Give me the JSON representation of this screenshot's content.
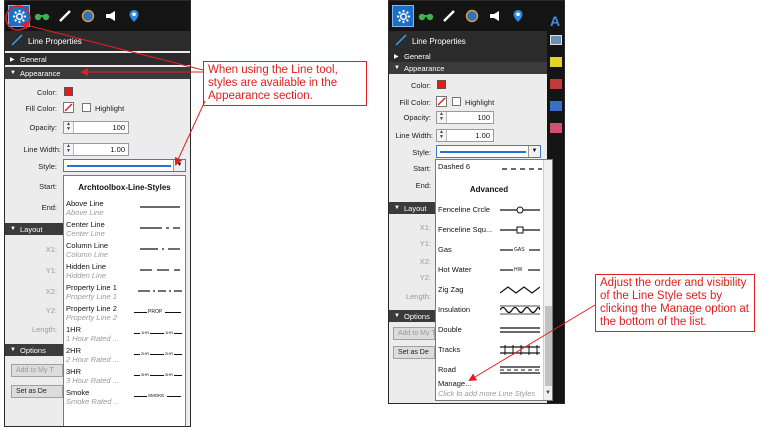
{
  "left_panel": {
    "title": "Line Properties",
    "sections": {
      "general": "General",
      "appearance": "Appearance",
      "layout": "Layout",
      "options": "Options"
    },
    "labels": {
      "color": "Color:",
      "fill_color": "Fill Color:",
      "highlight": "Highlight",
      "opacity": "Opacity:",
      "line_width": "Line Width:",
      "style": "Style:",
      "start": "Start:",
      "end": "End:",
      "x1": "X1:",
      "y1": "Y1:",
      "x2": "X2:",
      "y2": "Y2:",
      "length": "Length:"
    },
    "values": {
      "opacity": "100",
      "line_width": "1.00"
    },
    "buttons": {
      "add_to_my": "Add to My T",
      "set_as_default": "Set as De"
    },
    "style_list": {
      "header": "Archtoolbox-Line-Styles",
      "items": [
        {
          "name": "Above Line",
          "sub": "Above Line"
        },
        {
          "name": "Center Line",
          "sub": "Center Line"
        },
        {
          "name": "Column Line",
          "sub": "Column Line"
        },
        {
          "name": "Hidden Line",
          "sub": "Hidden Line"
        },
        {
          "name": "Property Line 1",
          "sub": "Property Line 1"
        },
        {
          "name": "Property Line 2",
          "sub": "Property Line 2"
        },
        {
          "name": "1HR",
          "sub": "1 Hour Rated ..."
        },
        {
          "name": "2HR",
          "sub": "2 Hour Rated ..."
        },
        {
          "name": "3HR",
          "sub": "3 Hour Rated ..."
        },
        {
          "name": "Smoke",
          "sub": "Smoke Rated ..."
        }
      ],
      "sample_labels": {
        "prop": "PROP",
        "1hr": "1HR",
        "1hr_b": "1HR",
        "2hr": "2HR",
        "2hr_b": "2HR",
        "3hr": "3HR",
        "3hr_b": "3HR",
        "smoke": "SMOKE"
      }
    }
  },
  "right_panel": {
    "title": "Line Properties",
    "sections": {
      "general": "General",
      "appearance": "Appearance",
      "layout": "Layout",
      "options": "Options"
    },
    "labels": {
      "color": "Color:",
      "fill_color": "Fill Color:",
      "highlight": "Highlight",
      "opacity": "Opacity:",
      "line_width": "Line Width:",
      "style": "Style:",
      "start": "Start:",
      "end": "End:",
      "x1": "X1:",
      "y1": "Y1:",
      "x2": "X2:",
      "y2": "Y2:",
      "length": "Length:"
    },
    "values": {
      "opacity": "100",
      "line_width": "1.00"
    },
    "buttons": {
      "add_to_my": "Add to My T",
      "set_as_default": "Set as De"
    },
    "style_list": {
      "top_item": "Dashed 6",
      "group_header": "Advanced",
      "items": [
        {
          "name": "Fenceline Crcle",
          "sample": "circle"
        },
        {
          "name": "Fenceline Squ...",
          "sample": "square"
        },
        {
          "name": "Gas",
          "sample": "gas",
          "tag": "GAS"
        },
        {
          "name": "Hot Water",
          "sample": "hw",
          "tag": "HW"
        },
        {
          "name": "Zig Zag",
          "sample": "zigzag"
        },
        {
          "name": "Insulation",
          "sample": "insulation"
        },
        {
          "name": "Double",
          "sample": "double"
        },
        {
          "name": "Tracks",
          "sample": "tracks"
        },
        {
          "name": "Road",
          "sample": "road"
        }
      ],
      "manage": "Manage...",
      "manage_hint": "Click to add more Line Styles"
    }
  },
  "callouts": {
    "top": "When using the Line tool, styles are available in the Appearance section.",
    "bottom": "Adjust the order and visibility of the Line Style sets by clicking the Manage option at the bottom of the list."
  },
  "colors": {
    "annotation": "#e02020",
    "accent": "#1d6fc4",
    "swatch": "#e21b1b"
  },
  "icons": {
    "toolbar": [
      "gear-icon",
      "binoculars-icon",
      "pencil-icon",
      "globe-icon",
      "megaphone-icon",
      "map-pin-icon"
    ],
    "right_side_toolbar": [
      "text-a-icon",
      "print-icon",
      "highlighter-icon",
      "pen-icon",
      "eraser-icon"
    ]
  }
}
